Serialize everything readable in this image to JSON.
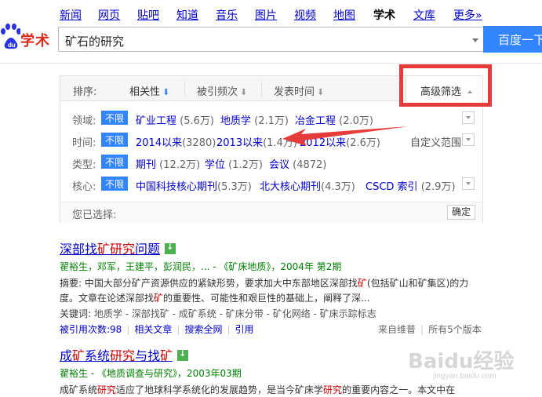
{
  "nav": {
    "items": [
      "新闻",
      "网页",
      "贴吧",
      "知道",
      "音乐",
      "图片",
      "视频",
      "地图",
      "学术",
      "文库",
      "更多»"
    ],
    "active": "学术"
  },
  "logo": {
    "text": "学术"
  },
  "search": {
    "value": "矿石的研究",
    "button": "百度一下"
  },
  "sort": {
    "label": "排序:",
    "items": [
      {
        "label": "相关性",
        "arrow": "⬇"
      },
      {
        "label": "被引频次",
        "arrow": "⬇"
      },
      {
        "label": "发表时间",
        "arrow": "⬇"
      }
    ],
    "advanced": "高级筛选"
  },
  "filters": [
    {
      "label": "领域:",
      "badge": "不限",
      "options": [
        {
          "name": "矿业工程",
          "count": "(5.6万)"
        },
        {
          "name": "地质学",
          "count": "(2.1万)"
        },
        {
          "name": "冶金工程",
          "count": "(2.0万)"
        }
      ]
    },
    {
      "label": "时间:",
      "badge": "不限",
      "options": [
        {
          "name": "2014以来",
          "count": "(3280)"
        },
        {
          "name": "2013以来",
          "count": "(1.4万)"
        },
        {
          "name": "2012以来",
          "count": "(2.6万)"
        }
      ],
      "custom": "自定义范围"
    },
    {
      "label": "类型:",
      "badge": "不限",
      "options": [
        {
          "name": "期刊",
          "count": "(12.2万)"
        },
        {
          "name": "学位",
          "count": "(1.2万)"
        },
        {
          "name": "会议",
          "count": "(4872)"
        }
      ]
    },
    {
      "label": "核心:",
      "badge": "不限",
      "options": [
        {
          "name": "中国科技核心期刊",
          "count": "(5.3万)"
        },
        {
          "name": "北大核心期刊",
          "count": "(4.3万)"
        },
        {
          "name": "CSCD 索引",
          "count": "(2.9万)"
        }
      ]
    }
  ],
  "selected": {
    "label": "您已选择:",
    "confirm": "确定"
  },
  "results": [
    {
      "title_parts": [
        [
          "深部找",
          ""
        ],
        [
          "矿",
          "em"
        ],
        [
          "研究",
          "em"
        ],
        [
          "问题",
          ""
        ]
      ],
      "meta": "翟裕生，邓军，王建平，彭润民，... - 《矿床地质》，2004年 第2期",
      "abstract_parts": [
        [
          "摘要:  中国大部分矿产资源供应的紧缺形势，要求加大中东部地区深部找",
          ""
        ],
        [
          "矿",
          "em"
        ],
        [
          "(包括矿山和矿集区)的力度。文章在论述深部找",
          ""
        ],
        [
          "矿",
          "em"
        ],
        [
          "的重要性、可能性和艰巨性的基础上，阐释了深...",
          ""
        ]
      ],
      "keywords_label": "关键词:",
      "keywords": "地质学 - 深部找矿 - 成矿系统 - 矿床分带 - 矿化网络 - 矿床示踪标志",
      "cited": "被引用次数:98",
      "related": "相关文章",
      "fulltext": "搜索全网",
      "quote": "引用",
      "source": "来自维普",
      "versions": "所有5个版本"
    },
    {
      "title_parts": [
        [
          "成",
          ""
        ],
        [
          "矿",
          "em"
        ],
        [
          "系统",
          ""
        ],
        [
          "研究",
          "em"
        ],
        [
          "与找",
          ""
        ],
        [
          "矿",
          "em"
        ]
      ],
      "meta": "翟裕生 - 《地质调查与研究》，2003年03期",
      "abstract_parts": [
        [
          "成矿系统",
          ""
        ],
        [
          "研究",
          "em"
        ],
        [
          "适应了地球科学系统化的发展趋势，是当今矿床学",
          ""
        ],
        [
          "研究",
          "em"
        ],
        [
          "的重要内容之一。本文中在",
          ""
        ]
      ]
    }
  ],
  "watermark": {
    "main": "Baidu经验",
    "sub": "jingyan.baidu.com"
  }
}
